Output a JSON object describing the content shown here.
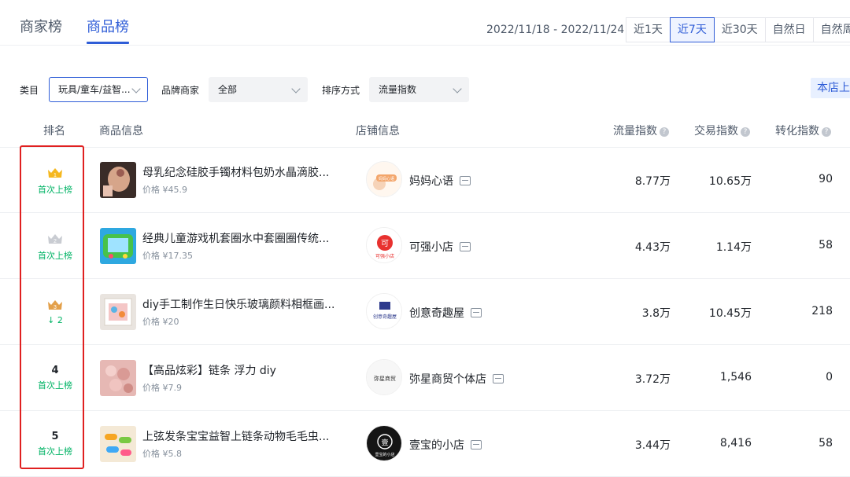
{
  "tabs": {
    "merchant": "商家榜",
    "product": "商品榜"
  },
  "date_range": "2022/11/18 - 2022/11/24",
  "range_buttons": [
    "近1天",
    "近7天",
    "近30天",
    "自然日",
    "自然周"
  ],
  "active_range": "近7天",
  "filters": {
    "category_label": "类目",
    "category_value": "玩具/童车/益智...",
    "brand_label": "品牌商家",
    "brand_value": "全部",
    "sort_label": "排序方式",
    "sort_value": "流量指数",
    "store_button": "本店上"
  },
  "columns": {
    "rank": "排名",
    "product": "商品信息",
    "store": "店铺信息",
    "traffic": "流量指数",
    "trade": "交易指数",
    "conversion": "转化指数"
  },
  "rows": [
    {
      "rank": "1",
      "rank_tag": "首次上榜",
      "product_name": "母乳纪念硅胶手镯材料包奶水晶滴胶...",
      "price": "价格 ¥45.9",
      "store_name": "妈妈心语",
      "store_logo_text": "妈妈心语",
      "traffic": "8.77万",
      "trade": "10.65万",
      "conversion": "90"
    },
    {
      "rank": "2",
      "rank_tag": "首次上榜",
      "product_name": "经典儿童游戏机套圈水中套圈圈传统...",
      "price": "价格 ¥17.35",
      "store_name": "可强小店",
      "store_logo_text": "可强小店",
      "traffic": "4.43万",
      "trade": "1.14万",
      "conversion": "58"
    },
    {
      "rank": "3",
      "rank_tag": "↓ 2",
      "product_name": "diy手工制作生日快乐玻璃颜料相框画...",
      "price": "价格 ¥20",
      "store_name": "创意奇趣屋",
      "store_logo_text": "创意奇趣屋",
      "traffic": "3.8万",
      "trade": "10.45万",
      "conversion": "218"
    },
    {
      "rank": "4",
      "rank_tag": "首次上榜",
      "product_name": "【高品炫彩】链条 浮力 diy",
      "price": "价格 ¥7.9",
      "store_name": "弥星商贸个体店",
      "store_logo_text": "弥星商贸",
      "traffic": "3.72万",
      "trade": "1,546",
      "conversion": "0"
    },
    {
      "rank": "5",
      "rank_tag": "首次上榜",
      "product_name": "上弦发条宝宝益智上链条动物毛毛虫...",
      "price": "价格 ¥5.8",
      "store_name": "壹宝的小店",
      "store_logo_text": "壹宝的小店",
      "traffic": "3.44万",
      "trade": "8,416",
      "conversion": "58"
    }
  ],
  "colors": {
    "accent": "#2f5dd7",
    "up_tag": "#00b365",
    "highlight_box": "#e02020"
  }
}
